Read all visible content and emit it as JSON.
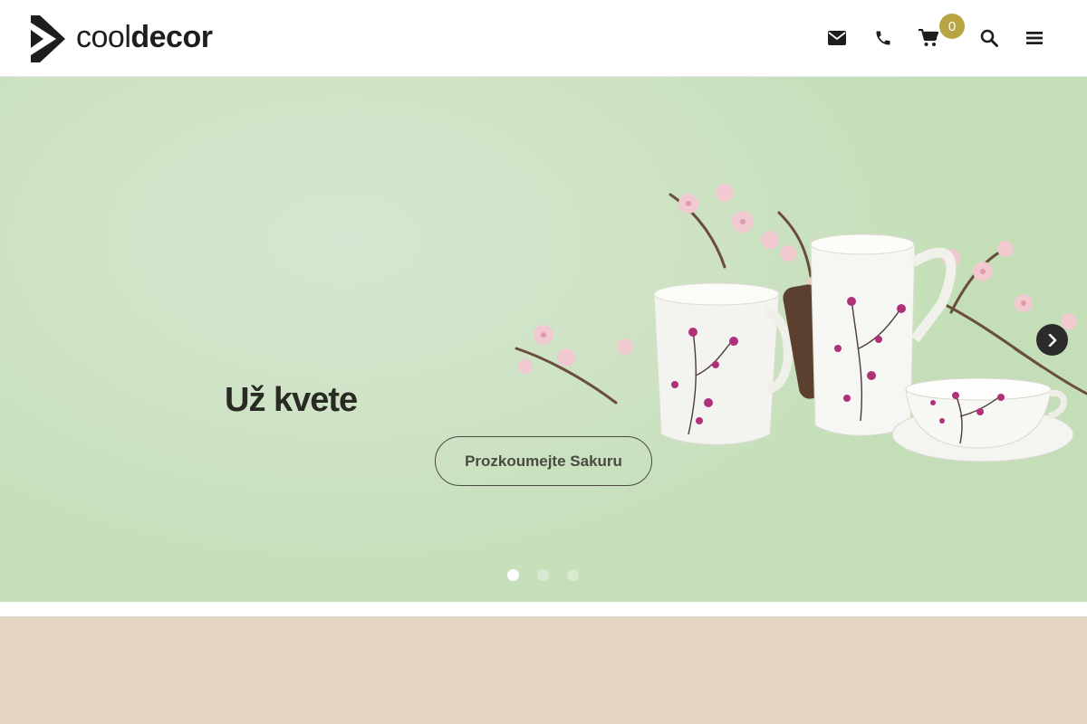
{
  "header": {
    "logo_light": "cool",
    "logo_bold": "decor",
    "icons": [
      "envelope-icon",
      "phone-icon",
      "cart-icon",
      "search-icon",
      "menu-icon"
    ],
    "cart_count": "0",
    "badge_color": "#b8a443"
  },
  "hero": {
    "title": "Už kvete",
    "cta_label": "Prozkoumejte Sakuru",
    "active_slide": 1,
    "slide_count": 3,
    "background_color": "#cfe3c6"
  },
  "section_band": {
    "color": "#e4d4c2"
  }
}
